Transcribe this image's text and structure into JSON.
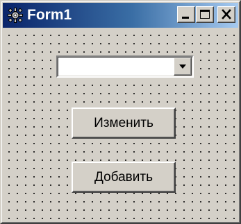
{
  "window": {
    "title": "Form1",
    "app_icon": "delphi-app-icon",
    "controls": {
      "minimize_icon": "minimize-icon",
      "maximize_icon": "maximize-icon",
      "close_icon": "close-icon"
    }
  },
  "form": {
    "combo": {
      "value": "",
      "dropdown_icon": "chevron-down-icon"
    },
    "buttons": {
      "change_label": "Изменить",
      "add_label": "Добавить"
    }
  },
  "colors": {
    "face": "#d4d0c8",
    "title_start": "#0a246a",
    "title_end": "#a6caf0",
    "grid_dot": "#000000"
  }
}
